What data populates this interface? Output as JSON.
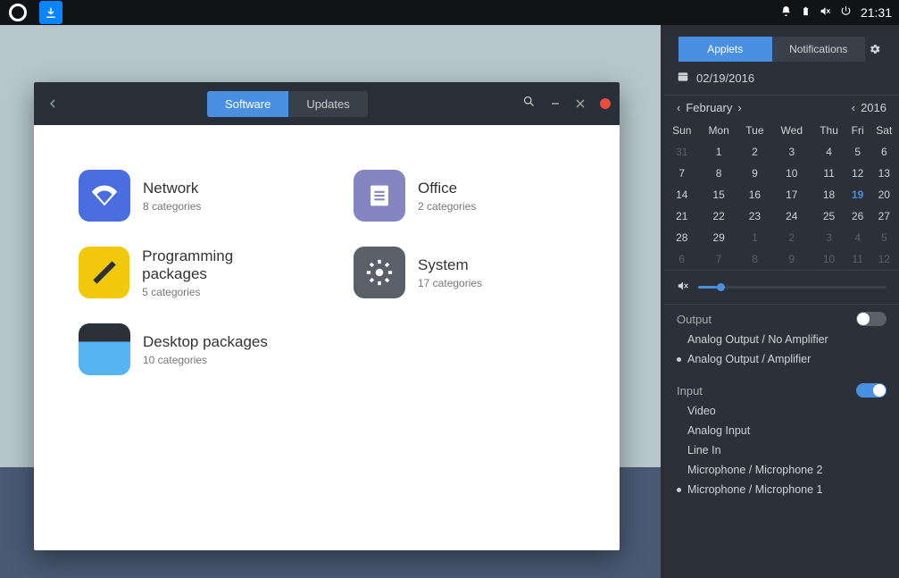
{
  "taskbar": {
    "clock": "21:31"
  },
  "software_window": {
    "tabs": {
      "software": "Software",
      "updates": "Updates"
    },
    "categories": {
      "network": {
        "label": "Network",
        "sub": "8 categories",
        "color": "#4a6ee0"
      },
      "office": {
        "label": "Office",
        "sub": "2 categories",
        "color": "#8585c2"
      },
      "programming": {
        "label": "Programming packages",
        "sub": "5 categories",
        "color": "#f3c90d"
      },
      "system": {
        "label": "System",
        "sub": "17 categories",
        "color": "#5a6069"
      },
      "desktop": {
        "label": "Desktop packages",
        "sub": "10 categories",
        "color": "#2c3139"
      }
    }
  },
  "sidebar": {
    "tabs": {
      "applets": "Applets",
      "notifications": "Notifications"
    },
    "date": "02/19/2016",
    "month": "February",
    "year": "2016",
    "dow": [
      "Sun",
      "Mon",
      "Tue",
      "Wed",
      "Thu",
      "Fri",
      "Sat"
    ],
    "weeks": [
      [
        {
          "n": "31",
          "dim": true
        },
        {
          "n": "1"
        },
        {
          "n": "2"
        },
        {
          "n": "3"
        },
        {
          "n": "4"
        },
        {
          "n": "5"
        },
        {
          "n": "6"
        }
      ],
      [
        {
          "n": "7"
        },
        {
          "n": "8"
        },
        {
          "n": "9"
        },
        {
          "n": "10"
        },
        {
          "n": "11"
        },
        {
          "n": "12"
        },
        {
          "n": "13"
        }
      ],
      [
        {
          "n": "14"
        },
        {
          "n": "15"
        },
        {
          "n": "16"
        },
        {
          "n": "17"
        },
        {
          "n": "18"
        },
        {
          "n": "19",
          "today": true
        },
        {
          "n": "20"
        }
      ],
      [
        {
          "n": "21"
        },
        {
          "n": "22"
        },
        {
          "n": "23"
        },
        {
          "n": "24"
        },
        {
          "n": "25"
        },
        {
          "n": "26"
        },
        {
          "n": "27"
        }
      ],
      [
        {
          "n": "28"
        },
        {
          "n": "29"
        },
        {
          "n": "1",
          "dim": true
        },
        {
          "n": "2",
          "dim": true
        },
        {
          "n": "3",
          "dim": true
        },
        {
          "n": "4",
          "dim": true
        },
        {
          "n": "5",
          "dim": true
        }
      ],
      [
        {
          "n": "6",
          "dim": true
        },
        {
          "n": "7",
          "dim": true
        },
        {
          "n": "8",
          "dim": true
        },
        {
          "n": "9",
          "dim": true
        },
        {
          "n": "10",
          "dim": true
        },
        {
          "n": "11",
          "dim": true
        },
        {
          "n": "12",
          "dim": true
        }
      ]
    ],
    "sound": {
      "output_label": "Output",
      "outputs": [
        "Analog Output / No Amplifier",
        "Analog Output / Amplifier"
      ],
      "output_selected": 1,
      "input_label": "Input",
      "inputs": [
        "Video",
        "Analog Input",
        "Line In",
        "Microphone / Microphone 2",
        "Microphone / Microphone 1"
      ],
      "input_selected": 4
    }
  }
}
